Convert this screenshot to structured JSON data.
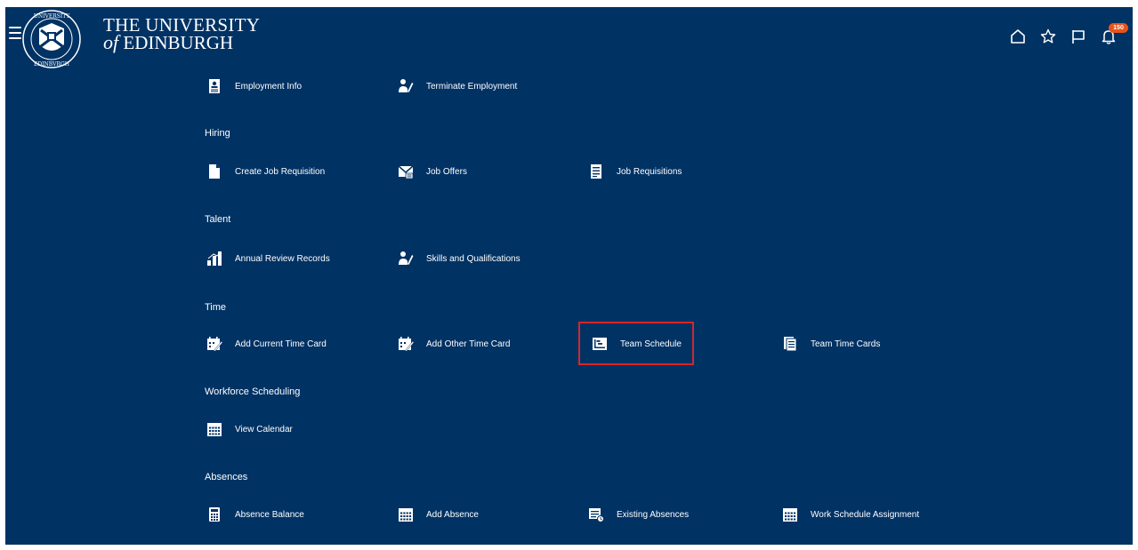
{
  "header": {
    "brand_line1": "THE UNIVERSITY",
    "brand_of": "of",
    "brand_line2": "EDINBURGH",
    "notification_count": "150",
    "icons": [
      "menu-icon",
      "home-icon",
      "star-icon",
      "flag-icon",
      "bell-icon"
    ]
  },
  "top_row": [
    {
      "label": "Employment Info",
      "icon": "id-badge-icon"
    },
    {
      "label": "Terminate Employment",
      "icon": "person-pencil-icon"
    }
  ],
  "sections": [
    {
      "title": "Hiring",
      "items": [
        {
          "label": "Create Job Requisition",
          "icon": "document-icon"
        },
        {
          "label": "Job Offers",
          "icon": "envelope-icon"
        },
        {
          "label": "Job Requisitions",
          "icon": "list-document-icon"
        }
      ]
    },
    {
      "title": "Talent",
      "items": [
        {
          "label": "Annual Review Records",
          "icon": "bar-chart-icon"
        },
        {
          "label": "Skills and Qualifications",
          "icon": "person-pencil-icon"
        }
      ]
    },
    {
      "title": "Time",
      "items": [
        {
          "label": "Add Current Time Card",
          "icon": "time-card-icon"
        },
        {
          "label": "Add Other Time Card",
          "icon": "time-card-icon"
        },
        {
          "label": "Team Schedule",
          "icon": "schedule-icon"
        },
        {
          "label": "Team Time Cards",
          "icon": "cards-icon"
        }
      ]
    },
    {
      "title": "Workforce Scheduling",
      "items": [
        {
          "label": "View Calendar",
          "icon": "calendar-icon"
        }
      ]
    },
    {
      "title": "Absences",
      "items": [
        {
          "label": "Absence Balance",
          "icon": "calculator-icon"
        },
        {
          "label": "Add Absence",
          "icon": "calendar-icon"
        },
        {
          "label": "Existing Absences",
          "icon": "absence-list-icon"
        },
        {
          "label": "Work Schedule Assignment",
          "icon": "calendar-icon"
        }
      ]
    }
  ],
  "colors": {
    "background": "#003264",
    "highlight_border": "#d62728",
    "badge": "#e8531a"
  }
}
